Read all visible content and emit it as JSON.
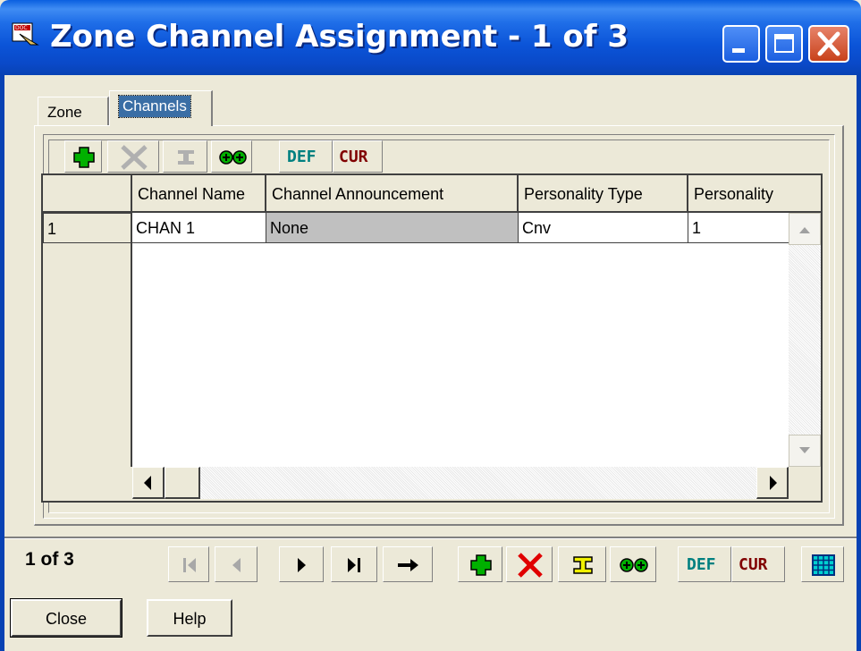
{
  "window": {
    "title": "Zone Channel Assignment - 1 of 3"
  },
  "tabs": [
    {
      "label": "Zone"
    },
    {
      "label": "Channels"
    }
  ],
  "grid": {
    "columns": [
      "",
      "Channel Name",
      "Channel Announcement",
      "Personality Type",
      "Personality"
    ],
    "rows": [
      {
        "row_num": "1",
        "channel_name": "CHAN 1",
        "channel_announcement": "None",
        "personality_type": "Cnv",
        "personality": "1"
      }
    ]
  },
  "toolbar": {
    "def_label": "DEF",
    "cur_label": "CUR"
  },
  "nav": {
    "record_info": "1 of 3",
    "def_label": "DEF",
    "cur_label": "CUR"
  },
  "buttons": {
    "close": "Close",
    "help": "Help"
  },
  "colors": {
    "titlebar": "#0a54d8",
    "selected_cell": "#c0c0c0",
    "add_green": "#00b000",
    "delete_red": "#e00000",
    "def_teal": "#008080",
    "cur_maroon": "#800000"
  }
}
